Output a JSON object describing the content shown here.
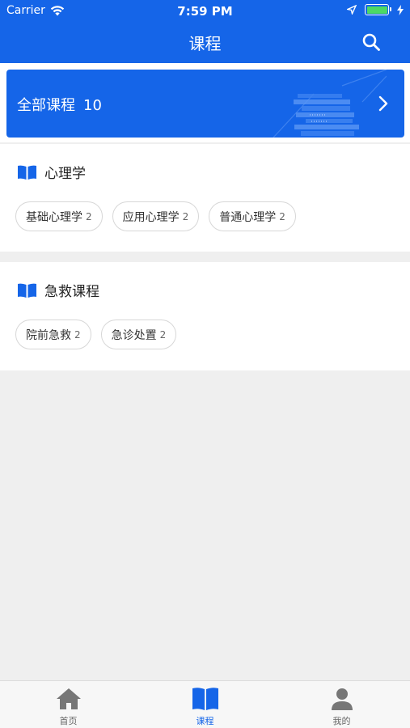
{
  "status": {
    "carrier": "Carrier",
    "time": "7:59 PM"
  },
  "nav": {
    "title": "课程"
  },
  "banner": {
    "label": "全部课程",
    "count": "10"
  },
  "categories": [
    {
      "title": "心理学",
      "tags": [
        {
          "label": "基础心理学",
          "count": "2"
        },
        {
          "label": "应用心理学",
          "count": "2"
        },
        {
          "label": "普通心理学",
          "count": "2"
        }
      ]
    },
    {
      "title": "急救课程",
      "tags": [
        {
          "label": "院前急救",
          "count": "2"
        },
        {
          "label": "急诊处置",
          "count": "2"
        }
      ]
    }
  ],
  "tabs": [
    {
      "label": "首页",
      "icon": "home-icon"
    },
    {
      "label": "课程",
      "icon": "book-icon",
      "active": true
    },
    {
      "label": "我的",
      "icon": "person-icon"
    }
  ],
  "colors": {
    "brand": "#1565e8",
    "background": "#efefef",
    "tab_inactive": "#777777"
  }
}
